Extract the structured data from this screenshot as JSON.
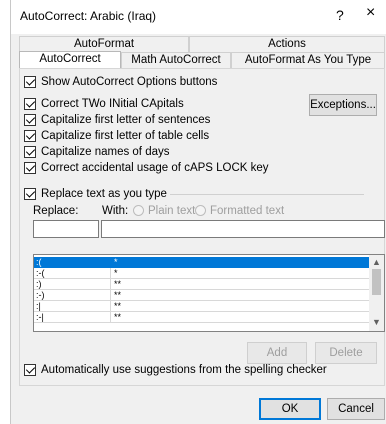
{
  "window": {
    "title": "AutoCorrect: Arabic (Iraq)",
    "help_glyph": "?",
    "close_glyph": "×"
  },
  "tabs": {
    "row1": [
      "AutoFormat",
      "Actions"
    ],
    "row2": [
      "AutoCorrect",
      "Math AutoCorrect",
      "AutoFormat As You Type"
    ],
    "selected": "AutoCorrect"
  },
  "options": {
    "show_buttons": "Show AutoCorrect Options buttons",
    "two_initial_caps": "Correct TWo INitial CApitals",
    "first_letter_sentences": "Capitalize first letter of sentences",
    "first_letter_table": "Capitalize first letter of table cells",
    "names_of_days": "Capitalize names of days",
    "caps_lock": "Correct accidental usage of cAPS LOCK key",
    "exceptions_button": "Exceptions...",
    "replace_as_you_type": "Replace text as you type",
    "replace_label": "Replace:",
    "with_label": "With:",
    "plain_text": "Plain text",
    "formatted_text": "Formatted text",
    "spelling_suggestions": "Automatically use suggestions from the spelling checker"
  },
  "replace_value": "",
  "with_value": "",
  "entries": [
    {
      "replace": ":(",
      "with": "*"
    },
    {
      "replace": ":-(",
      "with": "*"
    },
    {
      "replace": ":)",
      "with": "**"
    },
    {
      "replace": ":-)",
      "with": "**"
    },
    {
      "replace": ":|",
      "with": "**"
    },
    {
      "replace": ":-|",
      "with": "**"
    }
  ],
  "buttons": {
    "add": "Add",
    "delete": "Delete",
    "ok": "OK",
    "cancel": "Cancel"
  },
  "colors": {
    "selection": "#0078d7",
    "dialog_bg": "#f0f0f0"
  }
}
